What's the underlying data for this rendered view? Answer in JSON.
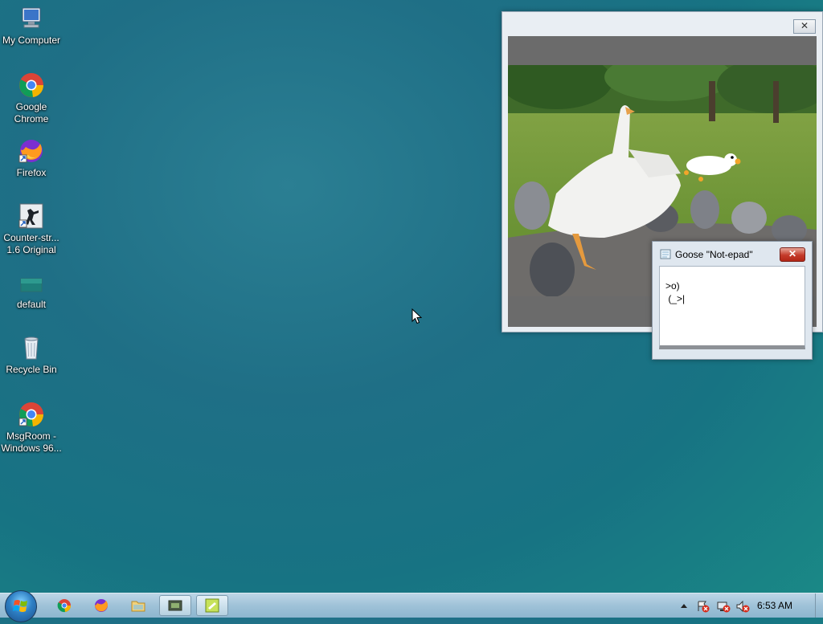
{
  "desktop": {
    "icons": [
      {
        "label": "My Computer"
      },
      {
        "label": "Google Chrome"
      },
      {
        "label": "Firefox"
      },
      {
        "label": "Counter-str... 1.6 Original"
      },
      {
        "label": "default"
      },
      {
        "label": "Recycle Bin"
      },
      {
        "label": "MsgRoom - Windows 96..."
      }
    ]
  },
  "media_window": {
    "close_glyph": "✕"
  },
  "goose_window": {
    "title": "Goose \"Not-epad\"",
    "close_glyph": "✕",
    "content": ">o)\n (_>|"
  },
  "taskbar": {
    "pinned": [
      "chrome-icon",
      "firefox-icon",
      "folder-icon",
      "media-player-icon",
      "notepad-icon"
    ],
    "clock": "6:53 AM"
  },
  "colors": {
    "desktop": "#1f6f86",
    "taskbar": "#a6c8dc",
    "close_red": "#c43b2a"
  }
}
